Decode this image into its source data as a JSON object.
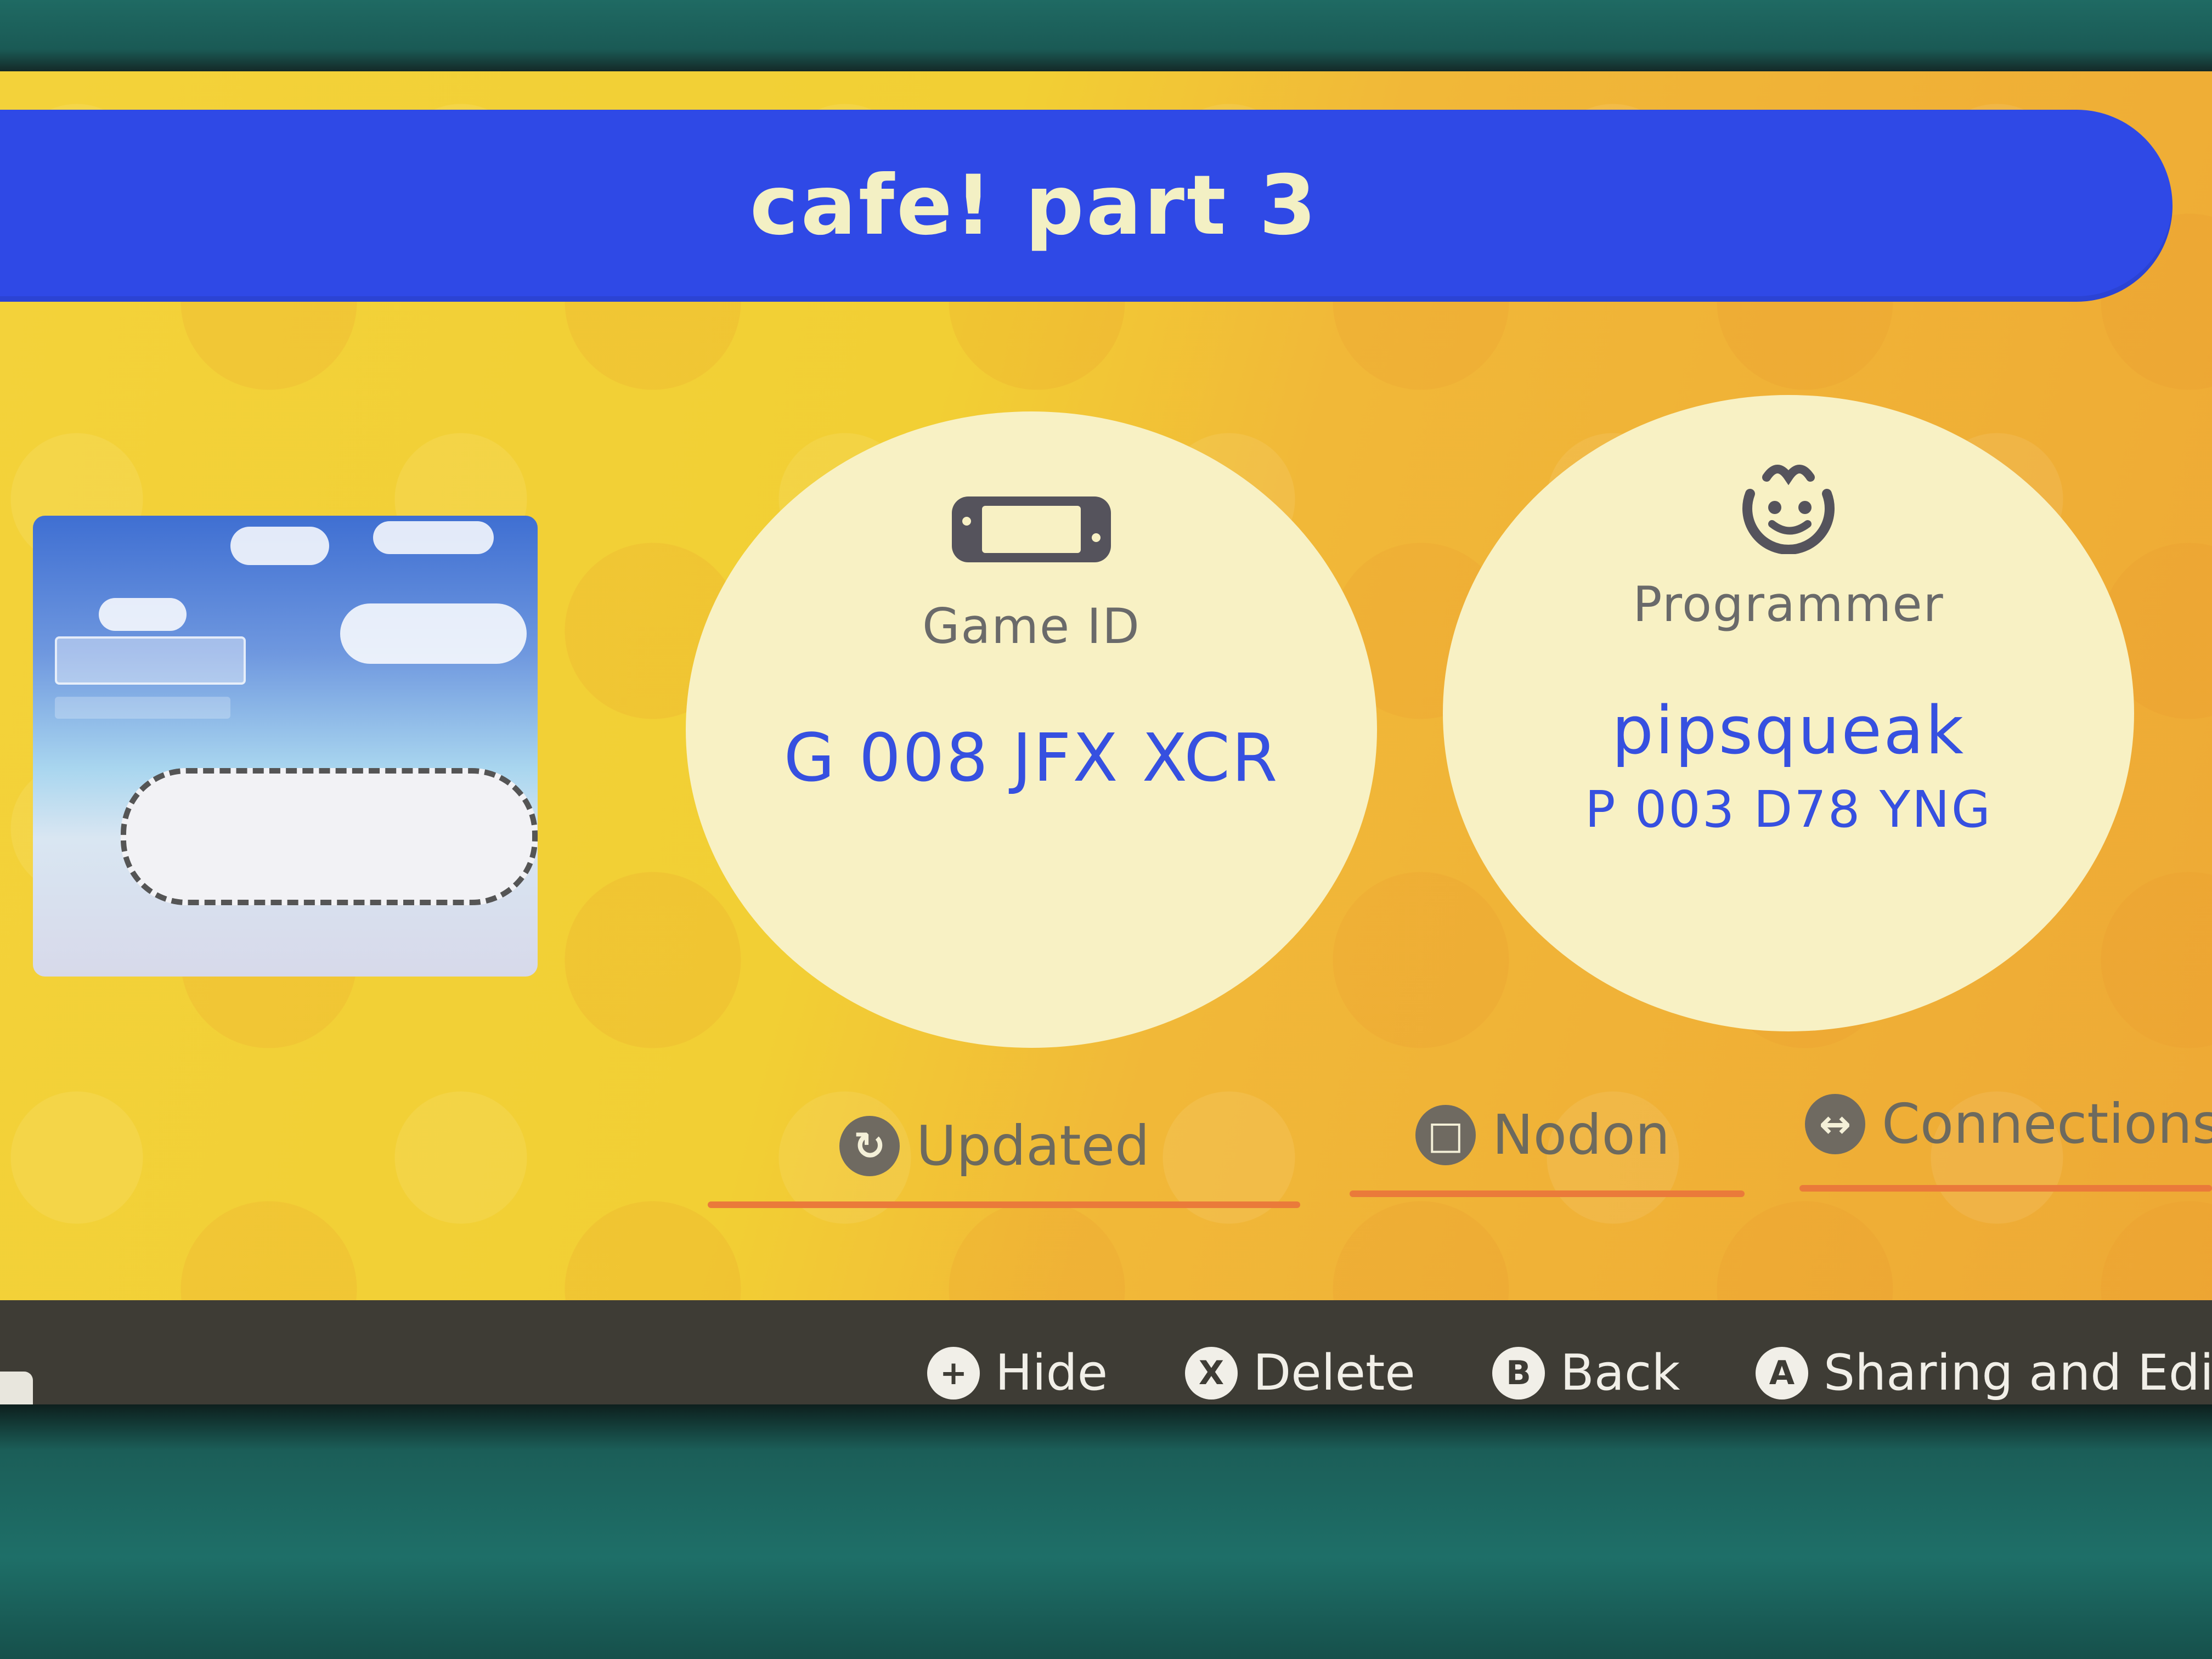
{
  "app": {
    "title": "cafe! part 3"
  },
  "game_id": {
    "label": "Game ID",
    "value": "G 008 JFX XCR",
    "icon": "console-icon"
  },
  "programmer": {
    "label": "Programmer",
    "name": "pipsqueak",
    "id": "P 003 D78 YNG",
    "icon": "smiley-face-icon"
  },
  "tabs": [
    {
      "label": "Updated",
      "icon": "refresh-icon"
    },
    {
      "label": "Nodon",
      "icon": "nodon-icon"
    },
    {
      "label": "Connections",
      "icon": "connections-icon"
    }
  ],
  "footer": {
    "items": [
      {
        "button": "+",
        "label": "Hide"
      },
      {
        "button": "X",
        "label": "Delete"
      },
      {
        "button": "B",
        "label": "Back"
      },
      {
        "button": "A",
        "label": "Sharing and Editi"
      }
    ]
  },
  "colors": {
    "title_bar": "#2f49e6",
    "title_text": "#f3f0c4",
    "background": "#f2cf34",
    "circle": "#f8f1c4",
    "value_text": "#3650e0",
    "footer": "#3e3c35",
    "tab_underline": "#ea7a3a",
    "bezel": "#1b5e58"
  }
}
